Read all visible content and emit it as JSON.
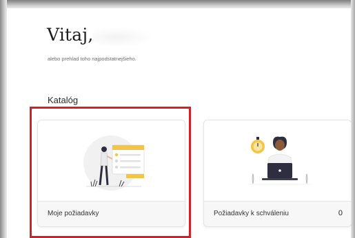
{
  "header": {
    "greeting": "Vitaj,",
    "subtitle": "alebo prehlad toho najpodstatnejšieho."
  },
  "catalog": {
    "title": "Katalóg",
    "cards": [
      {
        "label": "Moje požiadavky",
        "count": "",
        "illustration": "person-with-request-list-illustration",
        "highlighted": true
      },
      {
        "label": "Požiadavky k schváleniu",
        "count": "0",
        "illustration": "person-at-laptop-with-stopwatch-illustration",
        "highlighted": false
      }
    ]
  },
  "colors": {
    "highlight_border": "#d0202a",
    "accent_yellow": "#f5c542",
    "dark_figure": "#2f2e41",
    "card_footer_bg": "#f7f7f7"
  }
}
